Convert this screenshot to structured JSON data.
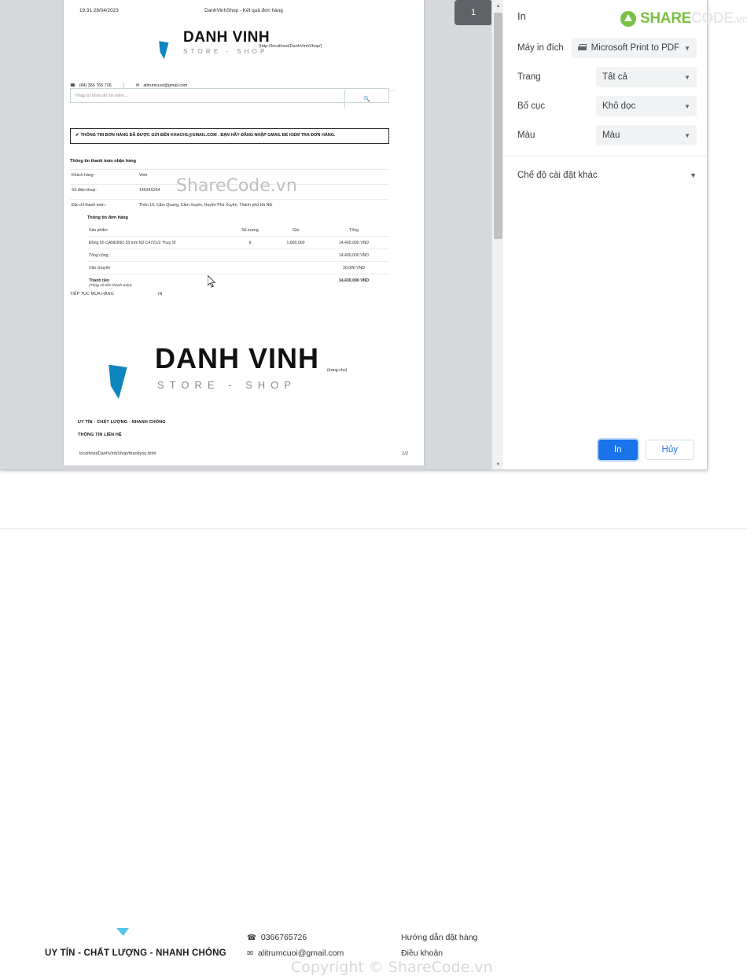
{
  "print_dialog": {
    "title": "In",
    "settings": [
      {
        "label": "Máy in đích",
        "value": "Microsoft Print to PDF",
        "icon": "printer-icon"
      },
      {
        "label": "Trang",
        "value": "Tất cả",
        "icon": ""
      },
      {
        "label": "Bố cục",
        "value": "Khổ dọc",
        "icon": ""
      },
      {
        "label": "Màu",
        "value": "Màu",
        "icon": ""
      }
    ],
    "more_settings_label": "Chế độ cài đặt khác",
    "print_button": "In",
    "cancel_button": "Hủy",
    "page_badge": "1"
  },
  "sharecode_logo": {
    "part1": "SHARE",
    "part2": "CODE",
    "part3": ".vn"
  },
  "preview": {
    "watermark": "ShareCode.vn",
    "header": {
      "timestamp": "19:31 28/04/2023",
      "doc_title": "DanhVinhShop - Kết quả đơn hàng"
    },
    "brand": {
      "name": "DANH VINH",
      "tagline": "STORE - SHOP",
      "url": "(http://localhost/DanhVinhShop/)"
    },
    "contact": {
      "phone": "(84) 366 765 726",
      "email": "alitrumcuoi@gmail.com"
    },
    "search": {
      "placeholder": "Nhập từ khóa để tìm kiếm...",
      "icon": "search-icon"
    },
    "alert": "THÔNG TIN ĐƠN HÀNG ĐÃ ĐƯỢC GỬI ĐẾN KHACH1@GMAIL.COM . BẠN HÃY ĐĂNG NHẬP GMAIL ĐỂ KIỂM TRA ĐƠN HÀNG.",
    "billing": {
      "section_title": "Thông tin thanh toán nhận hàng",
      "rows": [
        {
          "key": "Khách hàng :",
          "value": "Vinh"
        },
        {
          "key": "Số điện thoại :",
          "value": "14534S264"
        },
        {
          "key": "Địa chỉ thanh toán :",
          "value": "Thôn 10, Cẩm Quang, Cẩm Xuyên, Huyện Phú Xuyên, Thành phố Hà Nội"
        }
      ]
    },
    "order": {
      "section_title": "Thông tin đơn hàng",
      "columns": [
        "Sản phẩm",
        "Số lượng",
        "Giá",
        "Tổng"
      ],
      "items": [
        {
          "product": "Đồng hồ CANDINO 33 mm N2 C4721/2 Thuỵ Sĩ",
          "qty": "9",
          "price": "1,600,000",
          "total": "14,400,000 VND"
        }
      ],
      "summary": [
        {
          "label": "Tổng cộng :",
          "sub": "",
          "value": "14,400,000 VND",
          "bold": false
        },
        {
          "label": "Vận chuyển",
          "sub": "",
          "value": "30,000 VND",
          "bold": false
        },
        {
          "label": "Thành tiền",
          "sub": "(Tổng số tiền thanh toán)",
          "value": "14,430,000 VND",
          "bold": true
        }
      ]
    },
    "actions": {
      "continue_shopping": "TIẾP TỤC MUA HÀNG",
      "print": "IN"
    },
    "footer_logo_link": "(trang-chu)",
    "footer_line1": "UY TÍN - CHẤT LƯỢNG - NHANH CHÓNG",
    "footer_line2": "THÔNG TIN LIÊN HỆ",
    "page_footer": {
      "url": "localhost/DanhVinhShop/thankyou.html",
      "page_number": "1/2"
    }
  },
  "behind_page": {
    "slogan": "UY TÍN - CHẤT LƯỢNG - NHANH CHÓNG",
    "phone": "0366765726",
    "email": "alitrumcuoi@gmail.com",
    "link1": "Hướng dẫn đặt hàng",
    "link2": "Điều khoản",
    "copyright": "Copyright © ShareCode.vn"
  },
  "colors": {
    "accent_blue": "#1a73e8",
    "brand_cyan": "#1ab6ea",
    "sharecode_green": "#7ac143",
    "dialog_bg": "#d6d9dc"
  }
}
